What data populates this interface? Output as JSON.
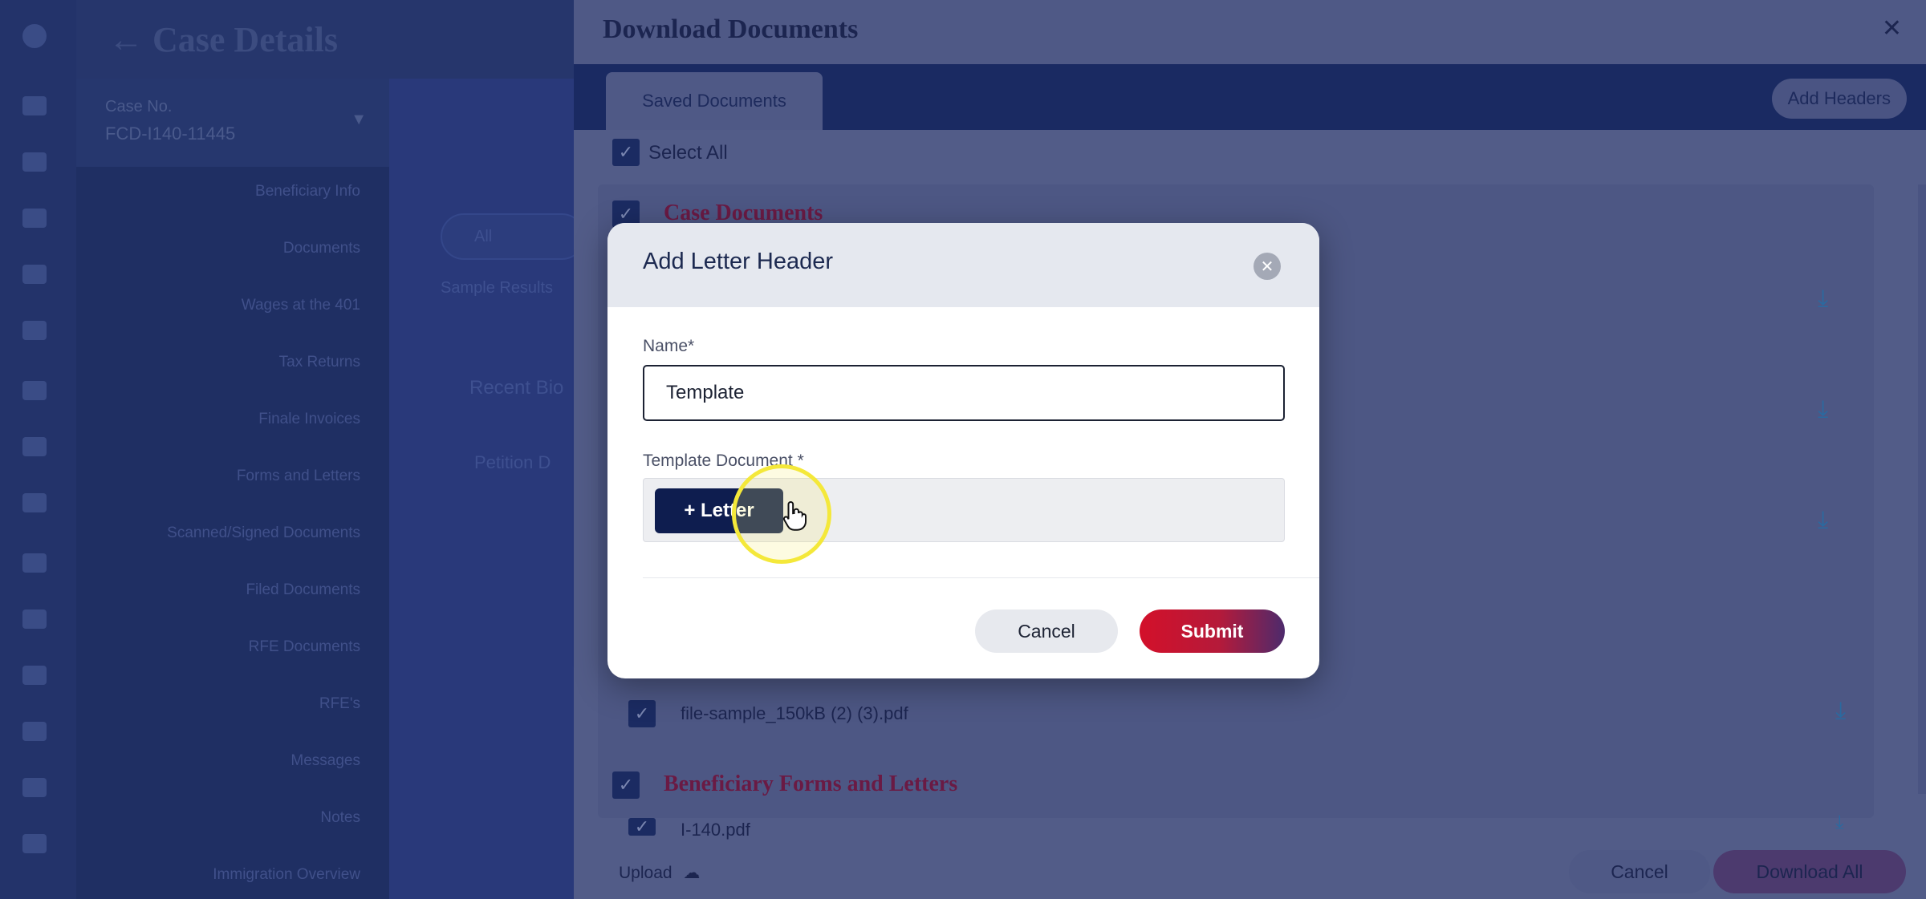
{
  "app": {
    "title": "Case Details",
    "case_selector": {
      "label": "Case No.",
      "value": "FCD-I140-11445"
    },
    "nav_items": [
      "Beneficiary Info",
      "Documents",
      "Wages at the 401",
      "Tax Returns",
      "Finale Invoices",
      "Forms and Letters",
      "Scanned/Signed Documents",
      "Filed Documents",
      "RFE Documents",
      "RFE's",
      "Messages",
      "Notes",
      "Immigration Overview"
    ],
    "middle": {
      "chip": "All",
      "filter": "Sample Results",
      "recent": "Recent Bio",
      "petition": "Petition D"
    }
  },
  "panel": {
    "title": "Download Documents",
    "close_icon": "close-icon",
    "tab_saved": "Saved Documents",
    "add_headers": "Add Headers",
    "select_all": "Select All",
    "section_case_documents": "Case Documents",
    "file_sample": "file-sample_150kB (2) (3).pdf",
    "section_beneficiary": "Beneficiary Forms and Letters",
    "file_i140": "I-140.pdf",
    "upload": "Upload",
    "cancel": "Cancel",
    "download_all": "Download All"
  },
  "modal": {
    "title": "Add Letter Header",
    "name_label": "Name*",
    "name_value": "Template",
    "template_label": "Template Document *",
    "letter_button": "+ Letter",
    "cancel": "Cancel",
    "submit": "Submit"
  },
  "colors": {
    "primary_navy": "#0e1d4f",
    "submit_red": "#d3102a",
    "section_maroon": "#6a1a44",
    "cursor_highlight": "#f4e83a"
  }
}
